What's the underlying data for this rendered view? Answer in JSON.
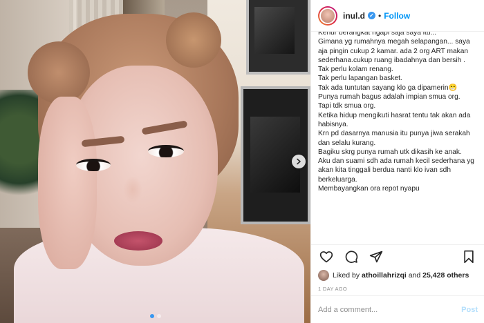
{
  "post": {
    "username": "inul.d",
    "verified_mark": "✓",
    "separator": "•",
    "follow_label": "Follow",
    "caption_lines": [
      "Kenur berangkat ngapi saja saya itu...",
      "Gimana yg rumahnya megah selapangan... saya aja pingin cukup 2 kamar. ada 2 org ART makan sederhana.cukup ruang ibadahnya dan bersih .",
      "Tak perlu kolam renang.",
      "Tak perlu lapangan basket.",
      "Tak ada tuntutan sayang klo ga dipamerin😁",
      "Punya rumah bagus adalah impian smua org.",
      "Tapi tdk smua org.",
      "Ketika hidup mengikuti hasrat tentu tak akan ada habisnya.",
      "Krn pd dasarnya manusia itu punya jiwa serakah dan selalu kurang.",
      "Bagiku skrg punya rumah utk dikasih ke anak.",
      "Aku dan suami sdh ada rumah kecil sederhana yg akan kita tinggali berdua nanti klo ivan sdh berkeluarga.",
      "Membayangkan ora repot nyapu"
    ],
    "likes": {
      "prefix": "Liked by",
      "user": "athoillahrizqi",
      "and": "and",
      "count": "25,428 others"
    },
    "time": "1 DAY AGO",
    "comment_placeholder": "Add a comment...",
    "post_label": "Post"
  },
  "carousel": {
    "slides": 2,
    "active_index": 0
  },
  "colors": {
    "accent": "#0095f6",
    "dot_active": "#3897f0",
    "post_disabled": "#b3dffc",
    "muted": "#8e8e8e"
  },
  "icons": {
    "like": "heart-icon",
    "comment": "comment-icon",
    "share": "share-icon",
    "save": "bookmark-icon",
    "next": "chevron-right-icon"
  }
}
